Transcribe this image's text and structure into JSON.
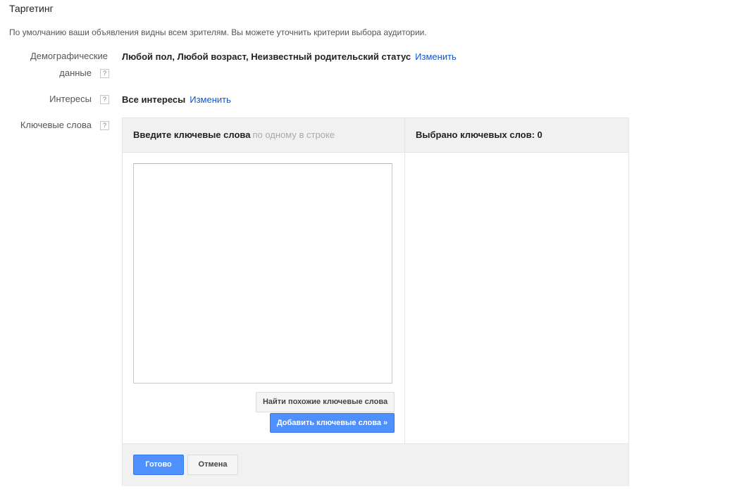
{
  "section": {
    "title": "Таргетинг",
    "subtitle": "По умолчанию ваши объявления видны всем зрителям. Вы можете уточнить критерии выбора аудитории."
  },
  "demographics": {
    "label_line1": "Демографические",
    "label_line2": "данные",
    "help": "?",
    "value": "Любой пол, Любой возраст, Неизвестный родительский статус",
    "change_link": "Изменить"
  },
  "interests": {
    "label": "Интересы",
    "help": "?",
    "value": "Все интересы",
    "change_link": "Изменить"
  },
  "keywords": {
    "label": "Ключевые слова",
    "help": "?",
    "input_header": "Введите ключевые слова",
    "input_hint": "по одному в строке",
    "selected_header": "Выбрано ключевых слов: 0",
    "textarea_value": "",
    "find_similar_button": "Найти похожие ключевые слова",
    "add_button": "Добавить ключевые слова »",
    "done_button": "Готово",
    "cancel_button": "Отмена"
  },
  "colors": {
    "link": "#1155cc",
    "primary_button": "#4d90fe",
    "panel_header_bg": "#f1f1f1"
  }
}
